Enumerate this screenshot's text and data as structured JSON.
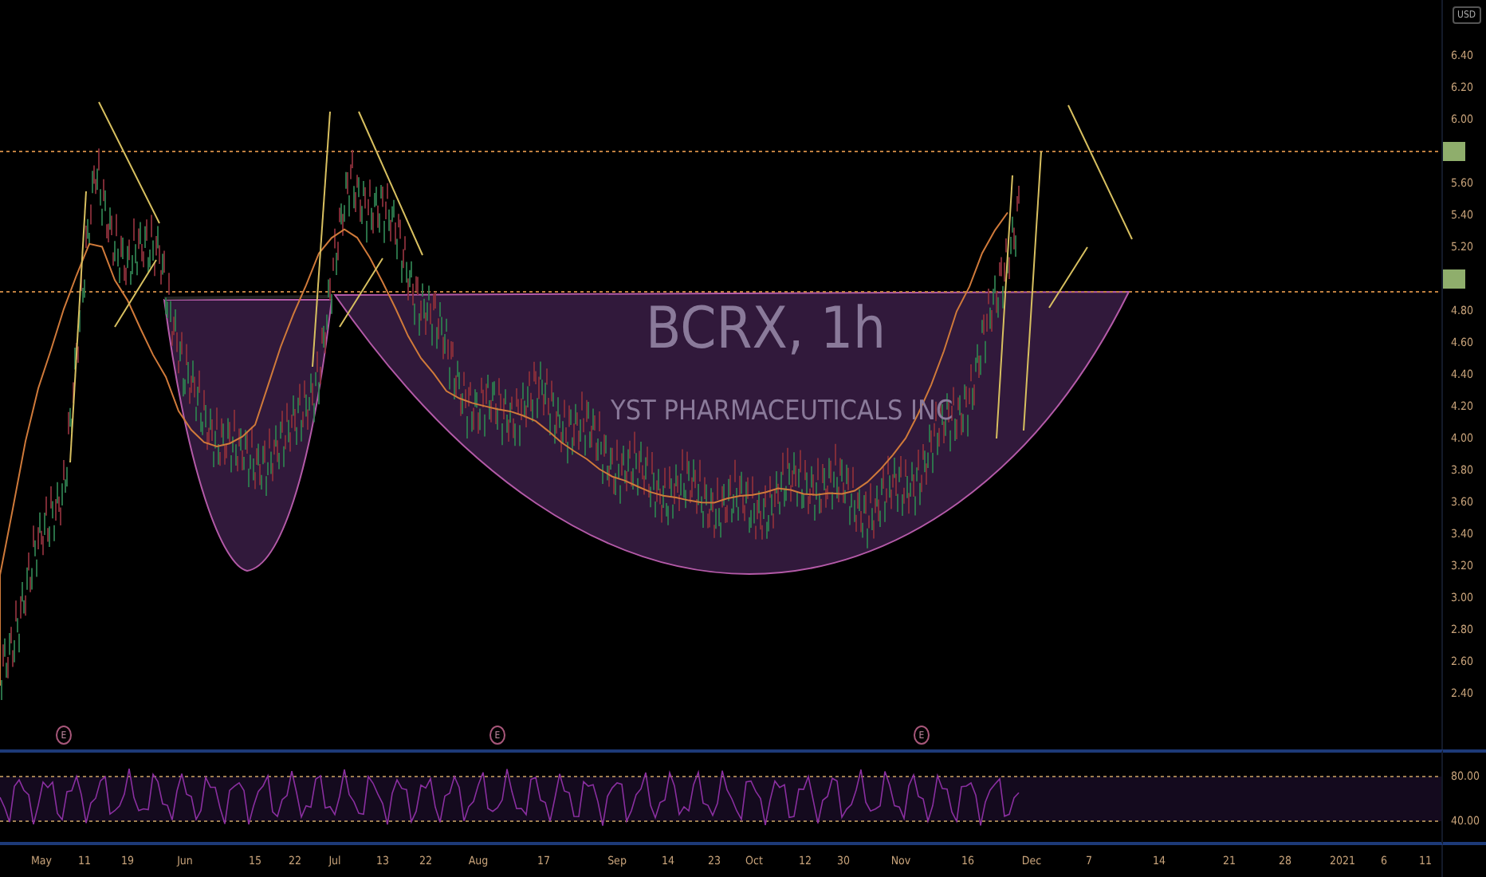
{
  "chart": {
    "symbol": "BCRX, 1h",
    "company": "YST PHARMACEUTICALS INC",
    "currency": "USD",
    "price_axis": [
      {
        "kind": "tick",
        "label": "6.40"
      },
      {
        "kind": "tick",
        "label": "6.20"
      },
      {
        "kind": "tick",
        "label": "6.00"
      },
      {
        "kind": "marker"
      },
      {
        "kind": "tick",
        "label": "5.60"
      },
      {
        "kind": "tick",
        "label": "5.40"
      },
      {
        "kind": "tick",
        "label": "5.20"
      },
      {
        "kind": "marker"
      },
      {
        "kind": "tick",
        "label": "4.80"
      },
      {
        "kind": "tick",
        "label": "4.60"
      },
      {
        "kind": "tick",
        "label": "4.40"
      },
      {
        "kind": "tick",
        "label": "4.20"
      },
      {
        "kind": "tick",
        "label": "4.00"
      },
      {
        "kind": "tick",
        "label": "3.80"
      },
      {
        "kind": "tick",
        "label": "3.60"
      },
      {
        "kind": "tick",
        "label": "3.40"
      },
      {
        "kind": "tick",
        "label": "3.20"
      },
      {
        "kind": "tick",
        "label": "3.00"
      },
      {
        "kind": "tick",
        "label": "2.80"
      },
      {
        "kind": "tick",
        "label": "2.60"
      },
      {
        "kind": "tick",
        "label": "2.40"
      }
    ],
    "events": [
      "E",
      "E",
      "E"
    ]
  },
  "indicator": {
    "levels": [
      "80.00",
      "40.00"
    ]
  },
  "time_axis": [
    "May",
    "11",
    "19",
    "Jun",
    "15",
    "22",
    "Jul",
    "13",
    "22",
    "Aug",
    "17",
    "Sep",
    "14",
    "23",
    "Oct",
    "12",
    "30",
    "Nov",
    "16",
    "Dec",
    "7",
    "14",
    "21",
    "28",
    "2021",
    "6",
    "11"
  ]
}
